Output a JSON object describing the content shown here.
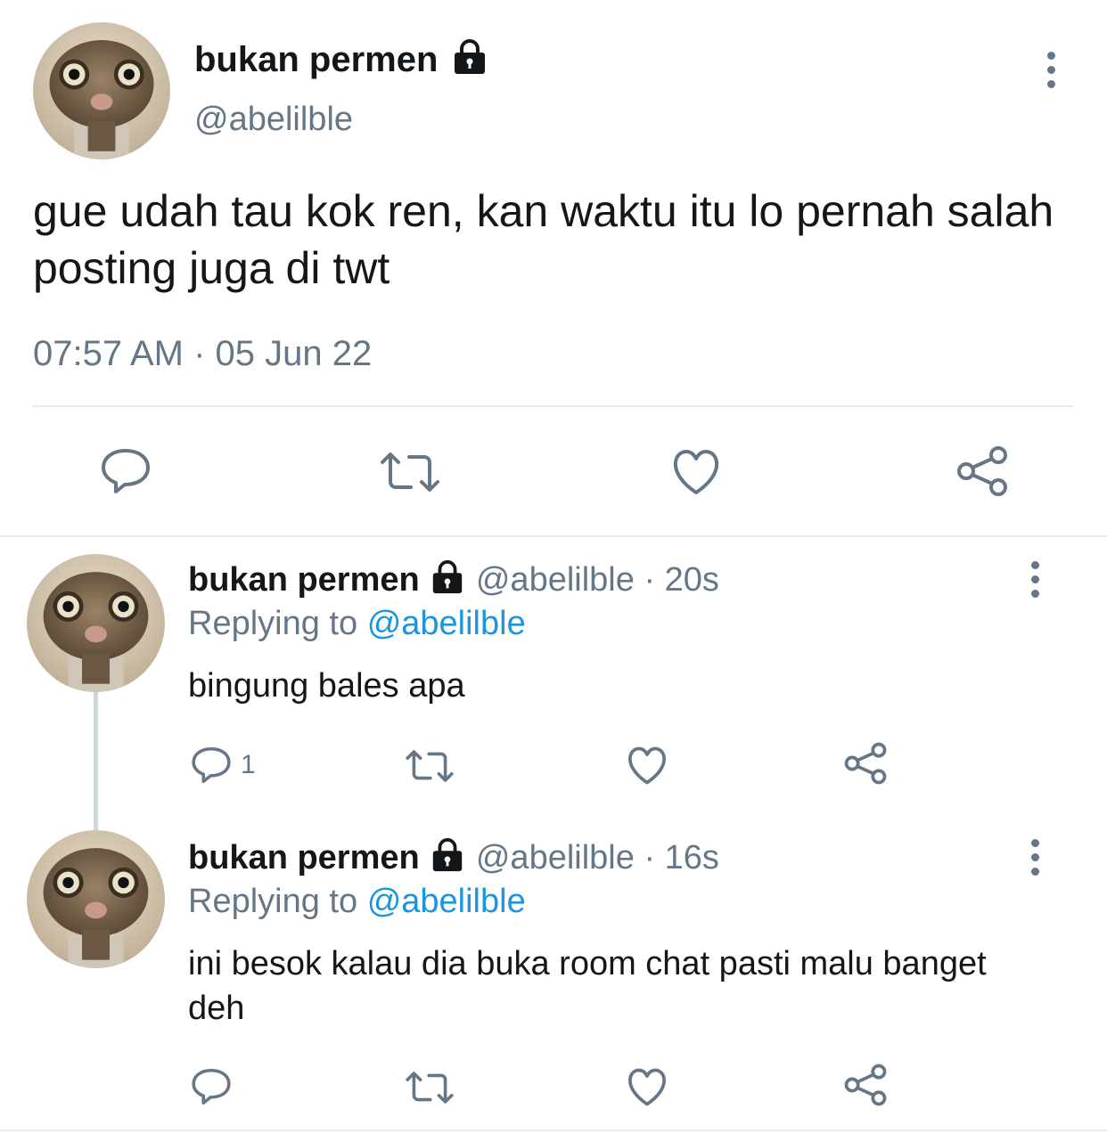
{
  "main_tweet": {
    "display_name": "bukan permen",
    "handle": "@abelilble",
    "text": "gue udah tau kok ren, kan waktu itu lo pernah salah posting juga di twt",
    "timestamp": "07:57 AM · 05 Jun 22"
  },
  "replies": [
    {
      "display_name": "bukan permen",
      "handle": "@abelilble",
      "time": "· 20s",
      "replying_label": "Replying to",
      "replying_to": "@abelilble",
      "text": "bingung bales apa",
      "reply_count": "1"
    },
    {
      "display_name": "bukan permen",
      "handle": "@abelilble",
      "time": "· 16s",
      "replying_label": "Replying to",
      "replying_to": "@abelilble",
      "text": "ini besok kalau dia buka room chat pasti malu banget deh",
      "reply_count": ""
    }
  ],
  "icons": {
    "reply": "reply-icon",
    "retweet": "retweet-icon",
    "like": "heart-icon",
    "share": "share-icon",
    "lock": "lock-icon",
    "more": "more-icon"
  },
  "colors": {
    "text": "#14171a",
    "muted": "#657786",
    "link": "#1b95e0",
    "divider": "#e6ecf0"
  }
}
